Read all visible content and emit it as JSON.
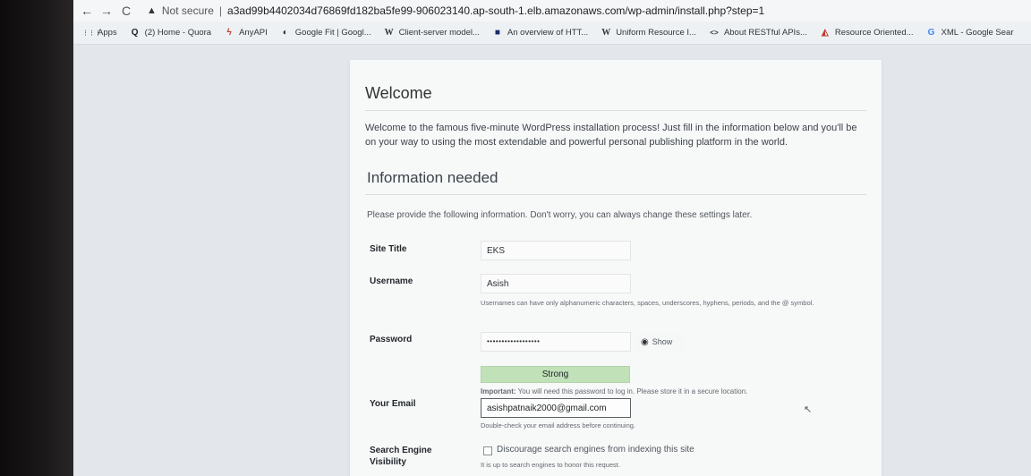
{
  "browser": {
    "back_icon": "arrow-left",
    "forward_icon": "arrow-right",
    "reload_icon": "reload",
    "security_warning": "▲",
    "security_label": "Not secure",
    "separator": "|",
    "url": "a3ad99b4402034d76869fd182ba5fe99-906023140.ap-south-1.elb.amazonaws.com/wp-admin/install.php?step=1"
  },
  "bookmarks": [
    {
      "icon": "⋮⋮⋮",
      "label": "Apps"
    },
    {
      "icon": "Q",
      "label": "(2) Home - Quora"
    },
    {
      "icon": "ϟ",
      "label": "AnyAPI"
    },
    {
      "icon": "◐",
      "label": "Google Fit | Googl..."
    },
    {
      "icon": "W",
      "label": "Client-server model..."
    },
    {
      "icon": "■",
      "label": "An overview of HTT..."
    },
    {
      "icon": "W",
      "label": "Uniform Resource I..."
    },
    {
      "icon": "<>",
      "label": "About RESTful APIs..."
    },
    {
      "icon": "◭",
      "label": "Resource Oriented..."
    },
    {
      "icon": "G",
      "label": "XML - Google Sear"
    }
  ],
  "install": {
    "welcome_heading": "Welcome",
    "intro": "Welcome to the famous five-minute WordPress installation process! Just fill in the information below and you'll be on your way to using the most extendable and powerful personal publishing platform in the world.",
    "info_heading": "Information needed",
    "info_note": "Please provide the following information. Don't worry, you can always change these settings later.",
    "site_title_label": "Site Title",
    "site_title_value": "EKS",
    "username_label": "Username",
    "username_value": "Asish",
    "username_hint": "Usernames can have only alphanumeric characters, spaces, underscores, hyphens, periods, and the @ symbol.",
    "password_label": "Password",
    "password_value": "••••••••••••••••••",
    "show_label": "Show",
    "strength_label": "Strong",
    "important_label": "Important:",
    "important_text": "You will need this password to log in. Please store it in a secure location.",
    "email_label": "Your Email",
    "email_value": "asishpatnaik2000@gmail.com",
    "email_hint": "Double-check your email address before continuing.",
    "search_label_1": "Search Engine",
    "search_label_2": "Visibility",
    "discourage_label": "Discourage search engines from indexing this site",
    "discourage_hint": "It is up to search engines to honor this request."
  }
}
